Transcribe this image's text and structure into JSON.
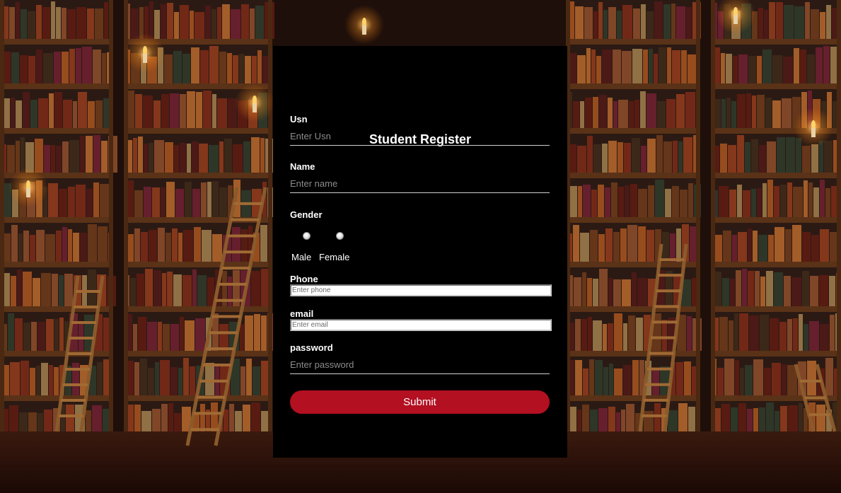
{
  "form": {
    "title": "Student Register",
    "usn": {
      "label": "Usn",
      "placeholder": "Enter Usn",
      "value": ""
    },
    "name": {
      "label": "Name",
      "placeholder": "Enter name",
      "value": ""
    },
    "gender": {
      "label": "Gender",
      "options": [
        "Male",
        "Female"
      ],
      "selected": null
    },
    "phone": {
      "label": "Phone",
      "placeholder": "Enter phone",
      "value": ""
    },
    "email": {
      "label": "email",
      "placeholder": "Enter email",
      "value": ""
    },
    "password": {
      "label": "password",
      "placeholder": "Enter password",
      "value": ""
    },
    "submit_label": "Submit"
  },
  "colors": {
    "card_background": "#000000",
    "submit_button": "#b31021",
    "text": "#ffffff",
    "placeholder": "#8c8c8c"
  },
  "background": {
    "scene": "library-bookshelves-with-ladders-and-candles"
  }
}
